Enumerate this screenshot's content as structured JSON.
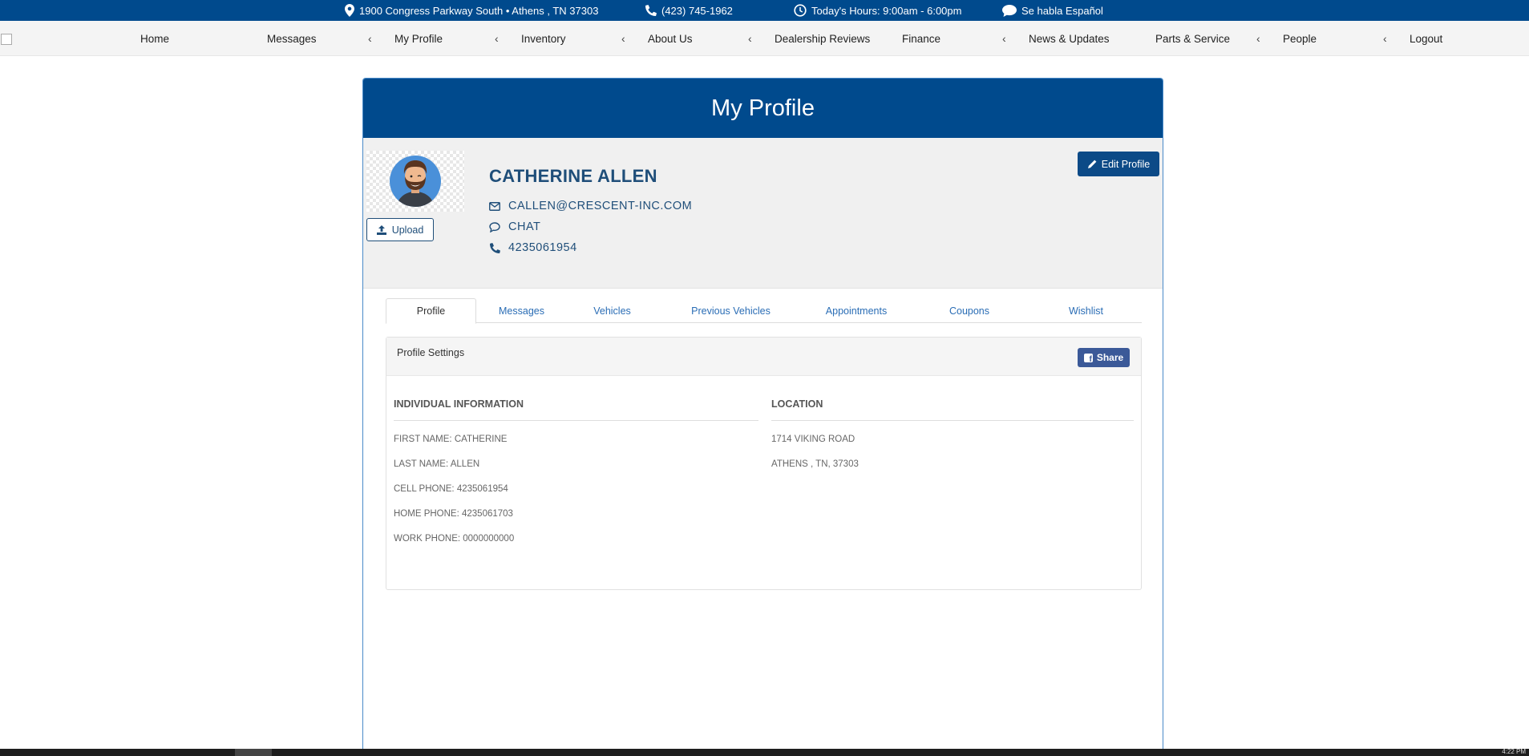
{
  "topbar": {
    "address": "1900 Congress Parkway South • Athens , TN 37303",
    "phone": "(423) 745-1962",
    "hours": "Today's Hours: 9:00am - 6:00pm",
    "spanish": "Se habla Español"
  },
  "nav": {
    "items": [
      "Home",
      "Messages",
      "My Profile",
      "Inventory",
      "About Us",
      "Dealership Reviews",
      "Finance",
      "News & Updates",
      "Parts & Service",
      "People",
      "Logout"
    ],
    "chevron": "‹"
  },
  "card": {
    "title": "My Profile",
    "upload_label": "Upload",
    "edit_label": "Edit Profile",
    "name": "CATHERINE ALLEN",
    "email": "CALLEN@CRESCENT-INC.COM",
    "chat": "CHAT",
    "phone": "4235061954"
  },
  "tabs": [
    "Profile",
    "Messages",
    "Vehicles",
    "Previous Vehicles",
    "Appointments",
    "Coupons",
    "Wishlist"
  ],
  "panel": {
    "title": "Profile Settings",
    "share_label": "Share",
    "individual": {
      "heading": "INDIVIDUAL INFORMATION",
      "fields": [
        "FIRST NAME: CATHERINE",
        "LAST NAME: ALLEN",
        "CELL PHONE: 4235061954",
        "HOME PHONE: 4235061703",
        "WORK PHONE: 0000000000"
      ]
    },
    "location": {
      "heading": "LOCATION",
      "fields": [
        "1714 VIKING ROAD",
        "ATHENS , TN, 37303"
      ]
    }
  },
  "taskbar": {
    "time": "4:22 PM"
  },
  "colors": {
    "brand_blue": "#004a8d",
    "link_blue": "#2a6db5",
    "facebook": "#3b5998"
  }
}
